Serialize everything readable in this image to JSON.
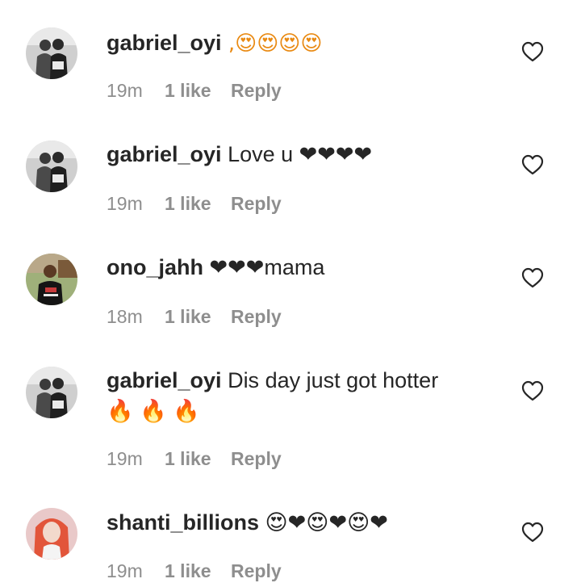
{
  "comments": [
    {
      "username": "gabriel_oyi",
      "text": " ,😍😍😍😍",
      "time": "19m",
      "likes": "1 like",
      "reply": "Reply",
      "avatar": "avatar-two-men-bw"
    },
    {
      "username": "gabriel_oyi",
      "text": " Love u ❤❤❤❤",
      "time": "19m",
      "likes": "1 like",
      "reply": "Reply",
      "avatar": "avatar-two-men-bw"
    },
    {
      "username": "ono_jahh",
      "text": " ❤❤❤mama",
      "time": "18m",
      "likes": "1 like",
      "reply": "Reply",
      "avatar": "avatar-man-outdoor"
    },
    {
      "username": "gabriel_oyi",
      "text": " Dis day just got hotter🔥 🔥 🔥",
      "time": "19m",
      "likes": "1 like",
      "reply": "Reply",
      "avatar": "avatar-two-men-bw"
    },
    {
      "username": "shanti_billions",
      "text": " 😍❤😍❤😍❤",
      "time": "19m",
      "likes": "1 like",
      "reply": "Reply",
      "avatar": "avatar-woman-red-hair"
    }
  ],
  "icons": {
    "like": "heart-outline-icon"
  },
  "colors": {
    "text": "#262626",
    "meta": "#8e8e8e",
    "heart": "#e0202e"
  }
}
